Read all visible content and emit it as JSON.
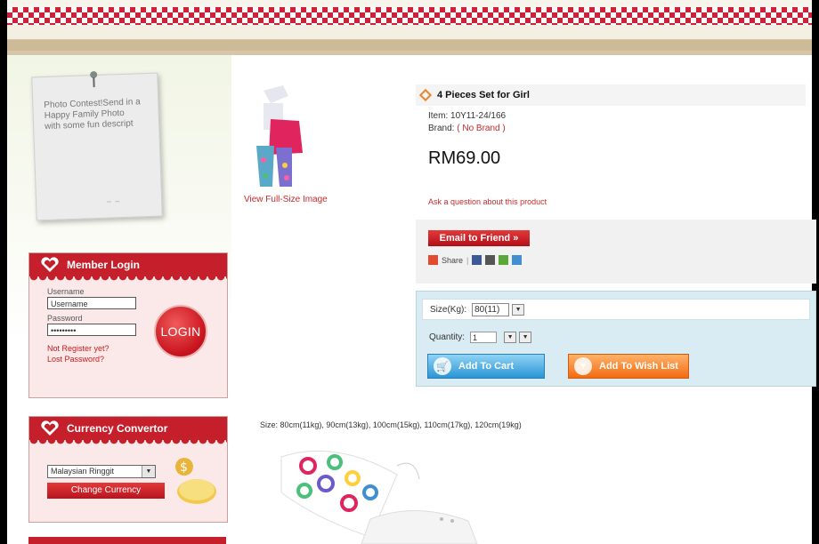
{
  "note": {
    "text": "Photo Contest!Send in a Happy Family Photo with some fun descript"
  },
  "login": {
    "title": "Member Login",
    "username_label": "Username",
    "username_value": "Username",
    "password_label": "Password",
    "password_value": "•••••••••",
    "login_button": "LOGIN",
    "not_registered": "Not Register yet?",
    "lost_password": "Lost Password?"
  },
  "currency": {
    "title": "Currency Convertor",
    "selected": "Malaysian Ringgit",
    "change_button": "Change Currency"
  },
  "product": {
    "view_full": "View Full-Size Image",
    "title": "4 Pieces Set for Girl",
    "item": "Item: 10Y11-24/166",
    "brand_label": "Brand:",
    "brand_value": "( No Brand )",
    "price": "RM69.00",
    "ask": "Ask a question about this product",
    "email_button": "Email to Friend",
    "share_label": "Share",
    "size_label": "Size(Kg):",
    "size_value": "80(11)",
    "quantity_label": "Quantity:",
    "quantity_value": "1",
    "add_to_cart": "Add To Cart",
    "add_to_wishlist": "Add To Wish List",
    "size_info": "Size: 80cm(11kg), 90cm(13kg), 100cm(15kg), 110cm(17kg), 120cm(19kg)"
  },
  "colors": {
    "accent_red": "#c41f2a",
    "cart_blue": "#2b95d6",
    "wish_orange": "#f26b12"
  }
}
